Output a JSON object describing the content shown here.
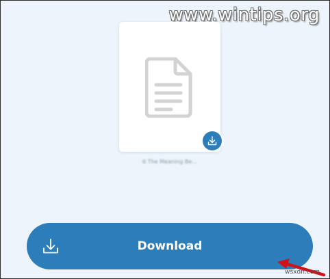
{
  "watermark": {
    "site": "www.wintips.org",
    "bottom": "wsxdn.com"
  },
  "file": {
    "name": "6 The Meaning Be...",
    "icon": "document-icon"
  },
  "actions": {
    "download_label": "Download",
    "download_icon": "download-icon"
  },
  "colors": {
    "background": "#edf4fc",
    "accent": "#2e7dbb",
    "card": "#ffffff",
    "annotation_arrow": "#d0121b"
  }
}
